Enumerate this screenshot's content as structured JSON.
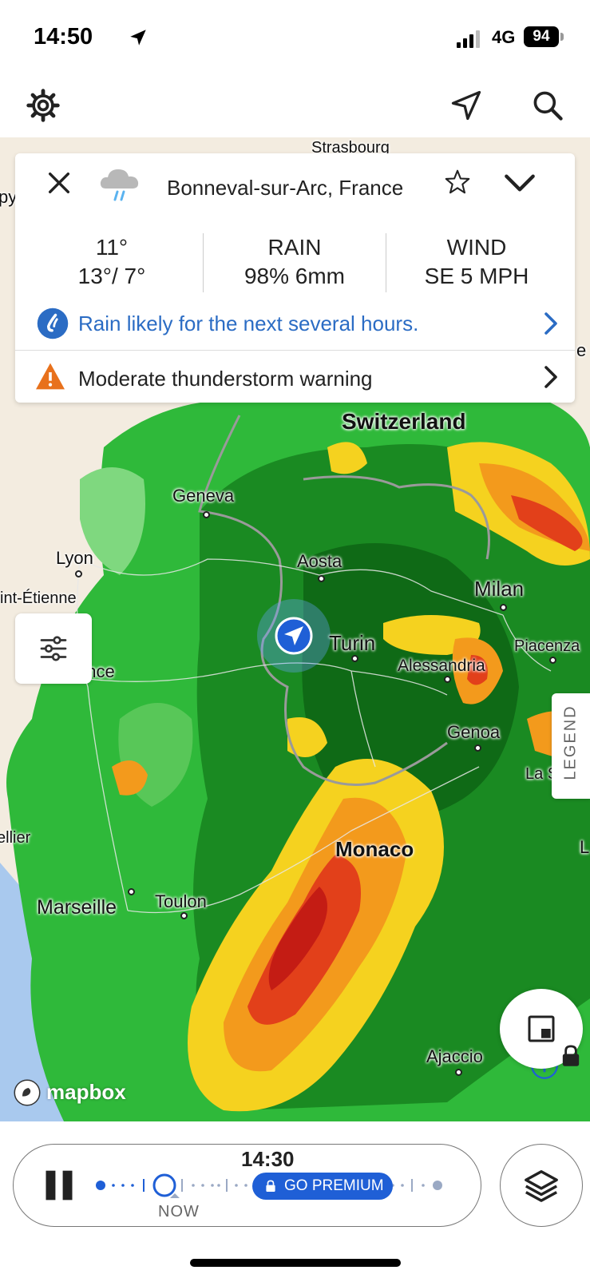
{
  "status_bar": {
    "time": "14:50",
    "network": "4G",
    "battery": "94"
  },
  "toolbar": {
    "icons": [
      "gear-icon",
      "location-arrow-icon",
      "search-icon"
    ]
  },
  "location_card": {
    "location": "Bonneval-sur-Arc, France",
    "icon": "rain-cloud-icon",
    "temp_now": "11°",
    "temp_range": "13°/ 7°",
    "rain_label": "RAIN",
    "rain_value": "98% 6mm",
    "wind_label": "WIND",
    "wind_value": "SE 5 MPH",
    "forecast_message": "Rain likely for the next several hours.",
    "warning": "Moderate thunderstorm warning"
  },
  "map": {
    "cities": {
      "strasbourg": "Strasbourg",
      "switzerland": "Switzerland",
      "geneva": "Geneva",
      "lyon": "Lyon",
      "saint_etienne": "int-Étienne",
      "valence": "ence",
      "aosta": "Aosta",
      "milan": "Milan",
      "turin": "Turin",
      "alessandria": "Alessandria",
      "piacenza": "Piacenza",
      "genoa": "Genoa",
      "la_spezia": "La Spez",
      "monaco": "Monaco",
      "montpellier": "ellier",
      "marseille": "Marseille",
      "toulon": "Toulon",
      "ajaccio": "Ajaccio",
      "left_edge_top": "py",
      "right_edge_top": "e",
      "right_edge_mid": "L"
    },
    "attribution": "mapbox",
    "legend_label": "LEGEND"
  },
  "playback": {
    "time": "14:30",
    "now_label": "NOW",
    "premium_label": "GO PREMIUM"
  },
  "colors": {
    "accent": "#1f5fd6",
    "info_blue": "#2b6cc4",
    "warning_orange": "#e8711c"
  }
}
